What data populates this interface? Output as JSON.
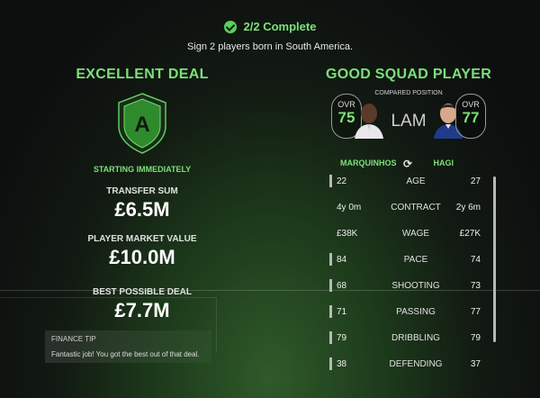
{
  "objective": {
    "status": "2/2 Complete",
    "description": "Sign 2 players born in South America."
  },
  "deal": {
    "heading": "EXCELLENT DEAL",
    "grade": "A",
    "timing": "STARTING IMMEDIATELY",
    "transfer_sum_label": "TRANSFER SUM",
    "transfer_sum": "£6.5M",
    "market_value_label": "PLAYER MARKET VALUE",
    "market_value": "£10.0M",
    "best_deal_label": "BEST POSSIBLE DEAL",
    "best_deal": "£7.7M"
  },
  "finance_tip": {
    "title": "FINANCE TIP",
    "text": "Fantastic job! You got the best out of that deal."
  },
  "comparison": {
    "heading": "GOOD SQUAD PLAYER",
    "compared_label": "COMPARED POSITION",
    "position": "LAM",
    "left_player": {
      "ovr_label": "OVR",
      "ovr": "75",
      "name": "MARQUINHOS"
    },
    "right_player": {
      "ovr_label": "OVR",
      "ovr": "77",
      "name": "HAGI"
    },
    "stats": [
      {
        "name": "AGE",
        "left": "22",
        "right": "27"
      },
      {
        "name": "CONTRACT",
        "left": "4y 0m",
        "right": "2y 6m"
      },
      {
        "name": "WAGE",
        "left": "£38K",
        "right": "£27K"
      },
      {
        "name": "PACE",
        "left": "84",
        "right": "74"
      },
      {
        "name": "SHOOTING",
        "left": "68",
        "right": "73"
      },
      {
        "name": "PASSING",
        "left": "71",
        "right": "77"
      },
      {
        "name": "DRIBBLING",
        "left": "79",
        "right": "79"
      },
      {
        "name": "DEFENDING",
        "left": "38",
        "right": "37"
      }
    ]
  },
  "colors": {
    "accent": "#7be07a",
    "badge_fill": "#2f8a2e"
  },
  "icons": {
    "complete": "check-circle-icon",
    "swap": "swap-icon"
  }
}
